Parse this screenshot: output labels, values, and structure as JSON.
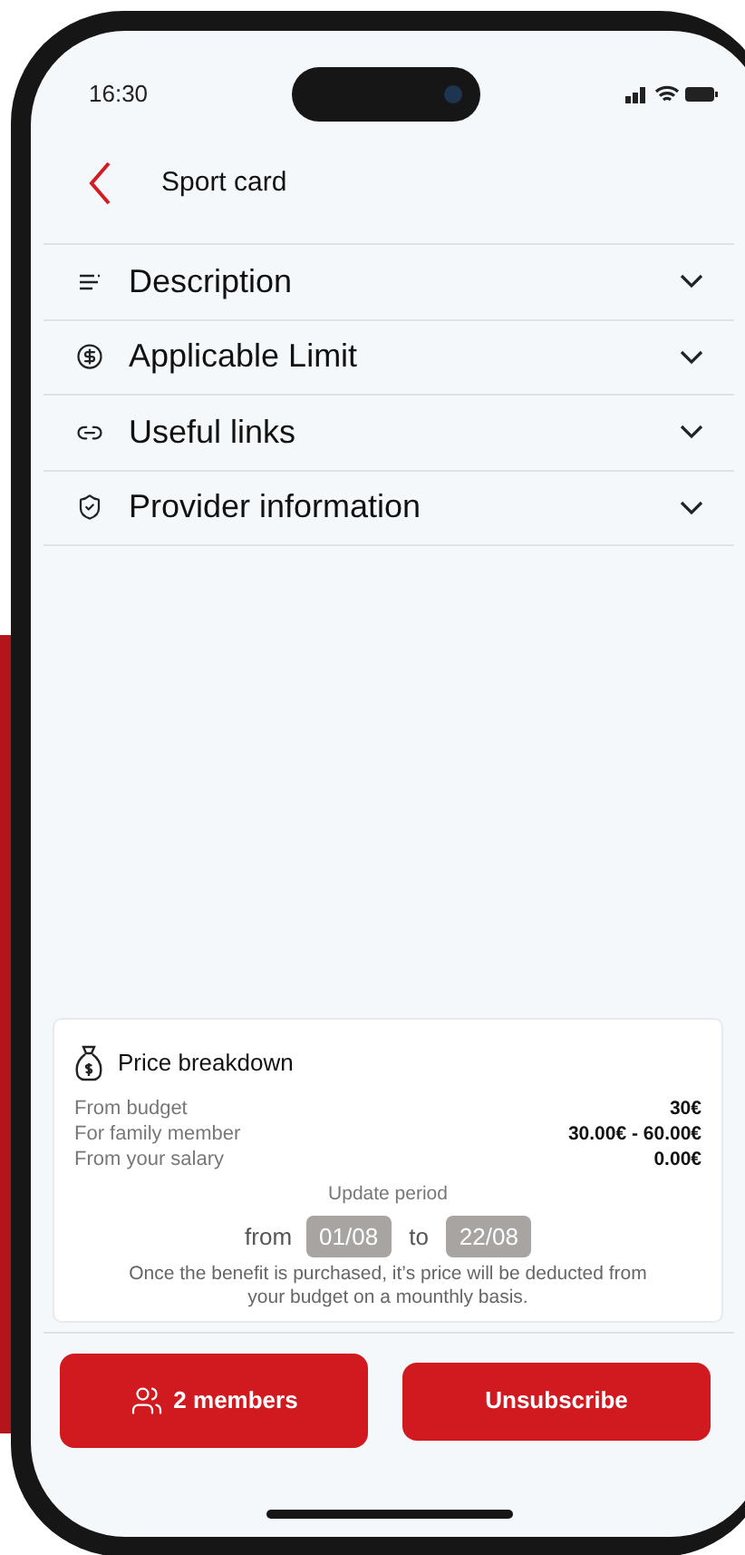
{
  "status_bar": {
    "time": "16:30"
  },
  "header": {
    "title": "Sport card"
  },
  "sections": [
    {
      "label": "Description",
      "kind": "description",
      "expanded": false
    },
    {
      "label": "Applicable Limit",
      "kind": "limit",
      "expanded": false
    },
    {
      "label": "Useful links",
      "kind": "links",
      "expanded": false
    },
    {
      "label": "Provider information",
      "kind": "provider",
      "expanded": false
    }
  ],
  "price_breakdown": {
    "title": "Price breakdown",
    "rows": [
      {
        "label": "From budget",
        "value": "30€"
      },
      {
        "label": "For family member",
        "value": "30.00€ - 60.00€"
      },
      {
        "label": "From your salary",
        "value": "0.00€"
      }
    ],
    "period_label": "Update period",
    "from_label": "from",
    "from_date": "01/08",
    "to_label": "to",
    "to_date": "22/08",
    "note": "Once the benefit is purchased, it’s price will be deducted from your budget on a mounthly basis."
  },
  "buttons": [
    {
      "label": "2 members",
      "kind": "members"
    },
    {
      "label": "Unsubscribe",
      "kind": "unsubscribe"
    }
  ]
}
